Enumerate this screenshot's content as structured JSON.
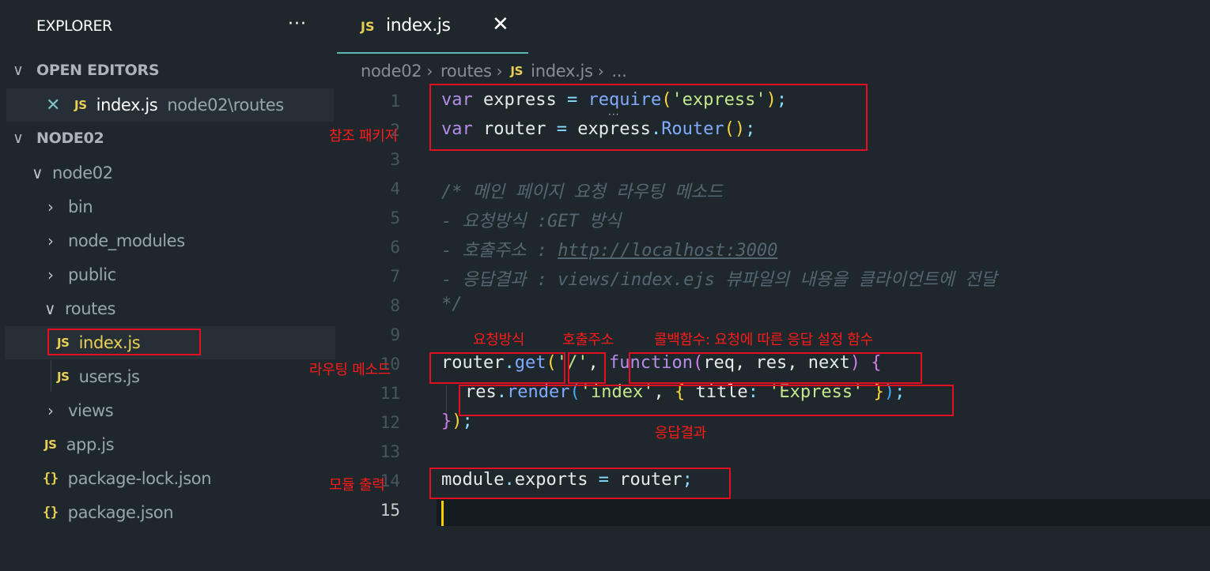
{
  "sidebar": {
    "title": "EXPLORER",
    "more": "···",
    "open_editors": {
      "label": "OPEN EDITORS",
      "item": {
        "icon": "JS",
        "name": "index.js",
        "path": "node02\\routes"
      }
    },
    "workspace": {
      "label": "NODE02",
      "tree": [
        {
          "label": "node02",
          "kind": "folder-open"
        },
        {
          "label": "bin",
          "kind": "folder"
        },
        {
          "label": "node_modules",
          "kind": "folder"
        },
        {
          "label": "public",
          "kind": "folder"
        },
        {
          "label": "routes",
          "kind": "folder-open"
        },
        {
          "label": "index.js",
          "kind": "js"
        },
        {
          "label": "users.js",
          "kind": "js"
        },
        {
          "label": "views",
          "kind": "folder"
        },
        {
          "label": "app.js",
          "kind": "js"
        },
        {
          "label": "package-lock.json",
          "kind": "json"
        },
        {
          "label": "package.json",
          "kind": "json"
        }
      ]
    },
    "icons": {
      "js": "JS",
      "json": "{}"
    }
  },
  "editor": {
    "tab": {
      "icon": "JS",
      "label": "index.js",
      "close": "✕"
    },
    "breadcrumb": [
      "node02",
      "routes",
      "index.js",
      "..."
    ],
    "line_numbers": [
      "1",
      "2",
      "3",
      "4",
      "5",
      "6",
      "7",
      "8",
      "9",
      "10",
      "11",
      "12",
      "13",
      "14",
      "15"
    ],
    "lines": {
      "l1": [
        "var",
        " express ",
        "=",
        " ",
        "require",
        "(",
        "'express'",
        ")",
        ";"
      ],
      "l2": [
        "var",
        " router ",
        "=",
        " express",
        ".",
        "Router",
        "(",
        ")",
        ";"
      ],
      "l4": "/* 메인 페이지 요청 라우팅 메소드",
      "l5": "- 요청방식 :GET 방식",
      "l6a": "- 호출주소 : ",
      "l6b": "http://localhost:3000",
      "l7": "- 응답결과 : views/index.ejs 뷰파일의 내용을 클라이언트에 전달",
      "l8": "*/",
      "l10": [
        "router",
        ".",
        "get",
        "(",
        "'/'",
        ", ",
        "function",
        "(",
        "req",
        ", ",
        "res",
        ", ",
        "next",
        ")",
        " ",
        "{"
      ],
      "l11": [
        "res",
        ".",
        "render",
        "(",
        "'index'",
        ", ",
        "{",
        " title",
        ": ",
        "'Express'",
        " ",
        "}",
        ")",
        ";"
      ],
      "l12": [
        "}",
        ")",
        ";"
      ],
      "l14": [
        "module",
        ".",
        "exports ",
        "=",
        " router",
        ";"
      ]
    }
  },
  "annotations": {
    "ref_package": "참조 패키지",
    "request_method": "요청방식",
    "call_address": "호출주소",
    "callback": "콜백함수: 요청에 따른 응답 설정 함수",
    "routing_method": "라우팅 메소드",
    "response_result": "응답결과",
    "module_export": "모듈 출력"
  },
  "colors": {
    "background": "#1e272c",
    "annotation_red": "#e01020",
    "keyword": "#b58de8",
    "function": "#82aaff",
    "string": "#c3e88d",
    "js_icon": "#e8cf55"
  }
}
